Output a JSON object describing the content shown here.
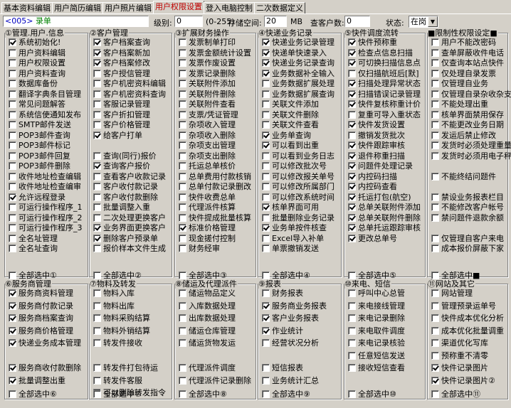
{
  "tabs": [
    "基本资料编辑",
    "用户简历编辑",
    "用户照片编辑",
    "用户权限设置",
    "登入电脑控制",
    "二次数据定义"
  ],
  "top": {
    "code": "<005>",
    "name": "录单",
    "level_label": "级别:",
    "level": "0",
    "level_range": "(0-255)",
    "storage_label": "存储空间:",
    "storage": "20",
    "storage_unit": "MB",
    "query_label": "查客户数:",
    "query": "0",
    "status_label": "状态:",
    "status": "在岗"
  },
  "groups": [
    {
      "title": "①管理.用户.信息",
      "check": true,
      "items": [
        [
          "系统初始化!",
          1
        ],
        [
          "用户资料编辑",
          0
        ],
        [
          "用户权限设置",
          0
        ],
        [
          "用户资料查询",
          0
        ],
        [
          "数据库备份",
          0
        ],
        [
          "翻译字典条目管理",
          0
        ],
        [
          "常见问题解答",
          0
        ],
        [
          "系统信使通知发布",
          0
        ],
        [
          "SMTP邮件发送",
          0
        ],
        [
          "POP3邮件查询",
          0
        ],
        [
          "POP3邮件标记",
          0
        ],
        [
          "POP3邮件回复",
          0
        ],
        [
          "POP3邮件删除",
          0
        ],
        [
          "收件地址检查编辑",
          0
        ],
        [
          "收件地址检查编审",
          0
        ],
        [
          "允许远程登录",
          1
        ],
        [
          "可运行操作程序_1",
          0
        ],
        [
          "可运行操作程序_2",
          0
        ],
        [
          "可运行操作程序_3",
          0
        ],
        [
          "全名址管理",
          0
        ],
        [
          "全名址查询",
          0
        ]
      ],
      "all": "全部选中①"
    },
    {
      "title": "②客户管理",
      "check": false,
      "items": [
        [
          "客户档案查询",
          1
        ],
        [
          "客户档案新加",
          1
        ],
        [
          "客户档案修改",
          1
        ],
        [
          "客户授信管理",
          0
        ],
        [
          "客户机密资料编辑",
          0
        ],
        [
          "客户机密资料查询",
          0
        ],
        [
          "客服记录管理",
          0
        ],
        [
          "客户折扣管理",
          0
        ],
        [
          "客户价格管理",
          0
        ],
        [
          "给客户打单",
          1
        ],
        [
          "",
          0
        ],
        [
          "查询(同行)报价",
          0
        ],
        [
          "查询客户报价",
          1
        ],
        [
          "查看客户收款记录",
          0
        ],
        [
          "客户收付款记录",
          0
        ],
        [
          "客户收付款删除",
          0
        ],
        [
          "批量调整入重",
          0
        ],
        [
          "二次处理更换客户",
          0
        ],
        [
          "业务界面更换客户",
          1
        ],
        [
          "删除客户预录单",
          1
        ],
        [
          "报价样本文件生成",
          0
        ]
      ],
      "all": "全部选中②"
    },
    {
      "title": "③扩展财务操作",
      "check": false,
      "items": [
        [
          "发票制单打印",
          0
        ],
        [
          "发票金额统计设置",
          0
        ],
        [
          "发票作废设置",
          0
        ],
        [
          "发票记录删除",
          0
        ],
        [
          "关联附件添加",
          0
        ],
        [
          "关联附件删除",
          0
        ],
        [
          "关联附件查看",
          0
        ],
        [
          "支票/凭证管理",
          0
        ],
        [
          "杂项收入管理",
          0
        ],
        [
          "杂项收入删除",
          0
        ],
        [
          "杂项支出管理",
          0
        ],
        [
          "杂项支出删除",
          0
        ],
        [
          "托运总单核价",
          0
        ],
        [
          "总单费用付款核销",
          0
        ],
        [
          "总单付款记录删改",
          0
        ],
        [
          "快件收费总单",
          0
        ],
        [
          "代理派件核算",
          0
        ],
        [
          "快件提成批量核算",
          0
        ],
        [
          "标准价格管理",
          1
        ],
        [
          "现金搓付控制",
          0
        ],
        [
          "财务经审",
          0
        ]
      ],
      "all": "全部选中③"
    },
    {
      "title": "④快递业务记录",
      "check": false,
      "items": [
        [
          "快递业务记录管理",
          1
        ],
        [
          "快递单快速录入",
          1
        ],
        [
          "快递业务记录查询",
          1
        ],
        [
          "业务数据补全输入",
          1
        ],
        [
          "业务数据扩展处理",
          0
        ],
        [
          "业务数据扩展查询",
          0
        ],
        [
          "关联文件添加",
          0
        ],
        [
          "关联文件删除",
          0
        ],
        [
          "关联文件查看",
          0
        ],
        [
          "业务单查询",
          1
        ],
        [
          "可以看到出重",
          1
        ],
        [
          "可以看到业务日志",
          0
        ],
        [
          "可以修改批次号",
          0
        ],
        [
          "可以修改报关单号",
          0
        ],
        [
          "可以修改所属部门",
          0
        ],
        [
          "可以修改系统时间",
          0
        ],
        [
          "核单界面可用",
          1
        ],
        [
          "批量删除业务记录",
          0
        ],
        [
          "业务单按件核查",
          1
        ],
        [
          "Excel导入补单",
          0
        ],
        [
          "单票撤销发送",
          0
        ]
      ],
      "all": "全部选中④"
    },
    {
      "title": "⑤快件调度流转",
      "check": false,
      "items": [
        [
          "快件预称重",
          1
        ],
        [
          "检查点信息扫描",
          1
        ],
        [
          "可切换扫描信息点",
          1
        ],
        [
          "仅扫描航班后[默]",
          0
        ],
        [
          "扫描处理异常状态",
          1
        ],
        [
          "扫描错误记录管理",
          1
        ],
        [
          "快件复核称重计价",
          1
        ],
        [
          "复重可导入重状态",
          0
        ],
        [
          "快件发货设置",
          1
        ],
        [
          "撤销发货批次",
          0
        ],
        [
          "快件跟踪审核",
          1
        ],
        [
          "退件称重扫描",
          1
        ],
        [
          "问题件处理记录",
          1
        ],
        [
          "内控码扫描",
          1
        ],
        [
          "内控码查看",
          1
        ],
        [
          "托运打包(航空)",
          1
        ],
        [
          "总单关联附件添加",
          1
        ],
        [
          "总单关联附件删除",
          1
        ],
        [
          "总单托运跟踪审核",
          1
        ],
        [
          "更改总单号",
          1
        ],
        [
          "",
          0
        ]
      ],
      "all": "全部选中⑤"
    },
    {
      "title": "■限制性权限设定■",
      "check": false,
      "items": [
        [
          "用户不能改密码",
          0
        ],
        [
          "查单屏蔽收件电话",
          0
        ],
        [
          "仅查询本站点快件",
          0
        ],
        [
          "仅处理自录发票",
          0
        ],
        [
          "仅管理自业务",
          0
        ],
        [
          "仅管理自录杂收杂支",
          0
        ],
        [
          "不能处理出重",
          0
        ],
        [
          "核单界面禁用保存",
          0
        ],
        [
          "不能更改业务日期",
          0
        ],
        [
          "发运后禁止修改",
          0
        ],
        [
          "发货时必须处理重量",
          0
        ],
        [
          "发货时必须用电子秤",
          0
        ],
        [
          "",
          0
        ],
        [
          "不能终结问题件",
          0
        ],
        [
          "",
          0
        ],
        [
          "禁设业务报表栏目",
          0
        ],
        [
          "不能修改客户帐号",
          0
        ],
        [
          "禁问题件退款余额",
          0
        ],
        [
          "",
          0
        ],
        [
          "仅管理自客户来电",
          0
        ],
        [
          "成本报价屏蔽下家",
          0
        ]
      ],
      "all": "全部选中■"
    },
    {
      "title": "⑥服务商管理",
      "check": false,
      "items": [
        [
          "服务商资料管理",
          1
        ],
        [
          "服务商付款记录",
          1
        ],
        [
          "服务商档案查询",
          1
        ],
        [
          "服务商价格管理",
          1
        ],
        [
          "快递业务成本管理",
          1
        ],
        [
          "",
          0
        ],
        [
          "服务商收付款删除",
          1
        ],
        [
          "批量调整出重",
          1
        ]
      ],
      "all": "全部选中⑥"
    },
    {
      "title": "⑦物料及转发",
      "check": false,
      "items": [
        [
          "物料入库",
          0
        ],
        [
          "物料出库",
          0
        ],
        [
          "物料采购结算",
          0
        ],
        [
          "物料外销结算",
          0
        ],
        [
          "转发件接收",
          0
        ],
        [
          "",
          0
        ],
        [
          "转发件打包待运",
          0
        ],
        [
          "转发件客服",
          0
        ],
        [
          "可以删除转发指令",
          0
        ]
      ],
      "all": "全部选中⑦"
    },
    {
      "title": "⑧储运及代理派件",
      "check": false,
      "items": [
        [
          "储运物品定义",
          0
        ],
        [
          "入库数据处理",
          0
        ],
        [
          "出库数据处理",
          0
        ],
        [
          "储运仓库管理",
          0
        ],
        [
          "储运货物发运",
          0
        ],
        [
          "",
          0
        ],
        [
          "代理派件调度",
          0
        ],
        [
          "代理派件记录删除",
          0
        ]
      ],
      "all": "全部选中⑧"
    },
    {
      "title": "⑨报表",
      "check": false,
      "items": [
        [
          "财务报表",
          0
        ],
        [
          "服务商业务报表",
          1
        ],
        [
          "客户业务报表",
          1
        ],
        [
          "作业统计",
          1
        ],
        [
          "经营状况分析",
          0
        ],
        [
          "",
          0
        ],
        [
          "短信报表",
          0
        ],
        [
          "业务统计汇总",
          0
        ]
      ],
      "all": "全部选中⑨"
    },
    {
      "title": "⑩来电、短信",
      "check": false,
      "items": [
        [
          "呼叫中心总管",
          0
        ],
        [
          "来电接线管理",
          0
        ],
        [
          "来电记录删除",
          0
        ],
        [
          "来电取件调度",
          0
        ],
        [
          "来电记录核验",
          0
        ],
        [
          "任意短信发送",
          0
        ],
        [
          "接收短信查看",
          0
        ]
      ],
      "all": "全部选中⑩"
    },
    {
      "title": "⑪网站及其它",
      "check": false,
      "items": [
        [
          "网站管理",
          0
        ],
        [
          "管理预录运单号",
          0
        ],
        [
          "快件成本优化分析",
          0
        ],
        [
          "成本优化批量调重",
          0
        ],
        [
          "渠道优化写库",
          0
        ],
        [
          "预称重不清零",
          0
        ],
        [
          "快件记录图片",
          1
        ],
        [
          "快件记录图片②",
          1
        ]
      ],
      "all": "全部选中⑪"
    }
  ]
}
